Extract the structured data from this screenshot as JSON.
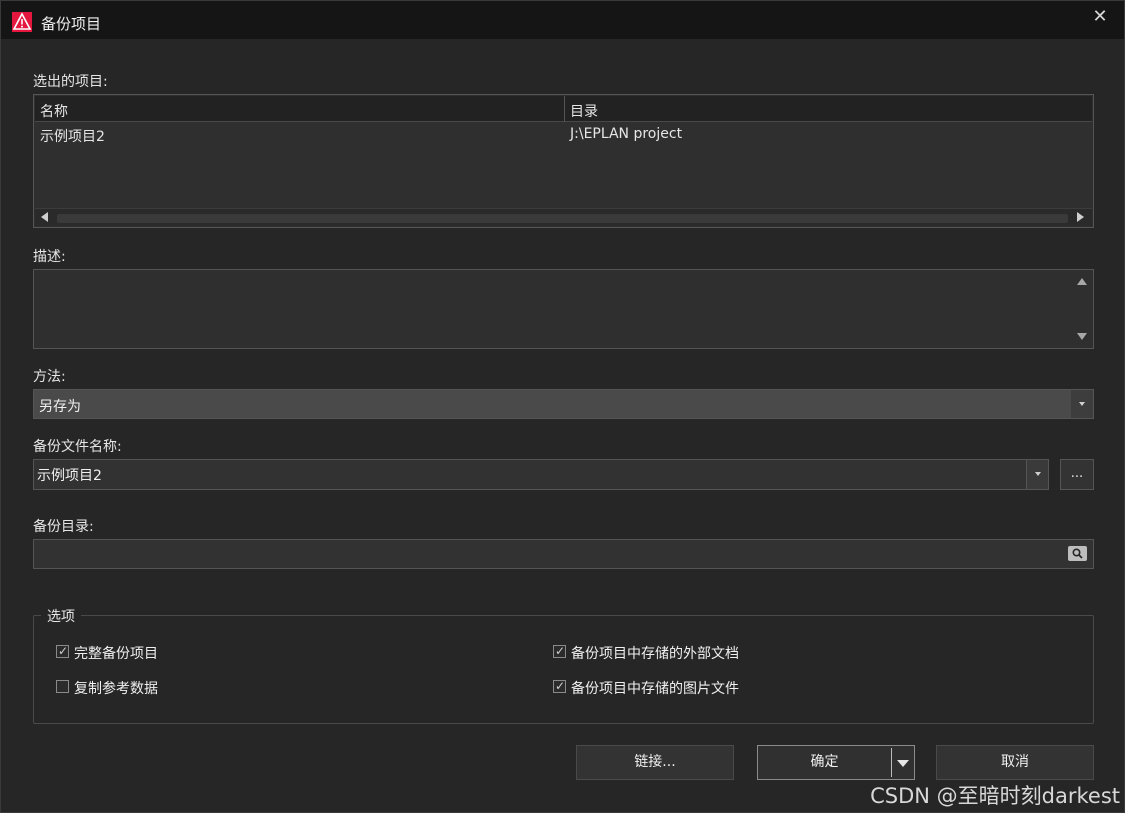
{
  "window": {
    "title": "备份项目",
    "close_glyph": "✕",
    "icon": "eplan-logo-icon",
    "accent": "#e5173f"
  },
  "selected_projects": {
    "label": "选出的项目:",
    "columns": [
      "名称",
      "目录"
    ],
    "rows": [
      {
        "name": "示例项目2",
        "directory": "J:\\EPLAN project"
      }
    ]
  },
  "description": {
    "label": "描述:",
    "value": ""
  },
  "method": {
    "label": "方法:",
    "value": "另存为"
  },
  "backup_file_name": {
    "label": "备份文件名称:",
    "value": "示例项目2",
    "browse_label": "..."
  },
  "backup_directory": {
    "label": "备份目录:",
    "value": ""
  },
  "options": {
    "title": "选项",
    "items": [
      {
        "label": "完整备份项目",
        "checked": true
      },
      {
        "label": "复制参考数据",
        "checked": false
      },
      {
        "label": "备份项目中存储的外部文档",
        "checked": true
      },
      {
        "label": "备份项目中存储的图片文件",
        "checked": true
      }
    ],
    "check_glyph": "✓"
  },
  "buttons": {
    "link": "链接...",
    "ok": "确定",
    "cancel": "取消"
  },
  "watermark": "CSDN @至暗时刻darkest"
}
